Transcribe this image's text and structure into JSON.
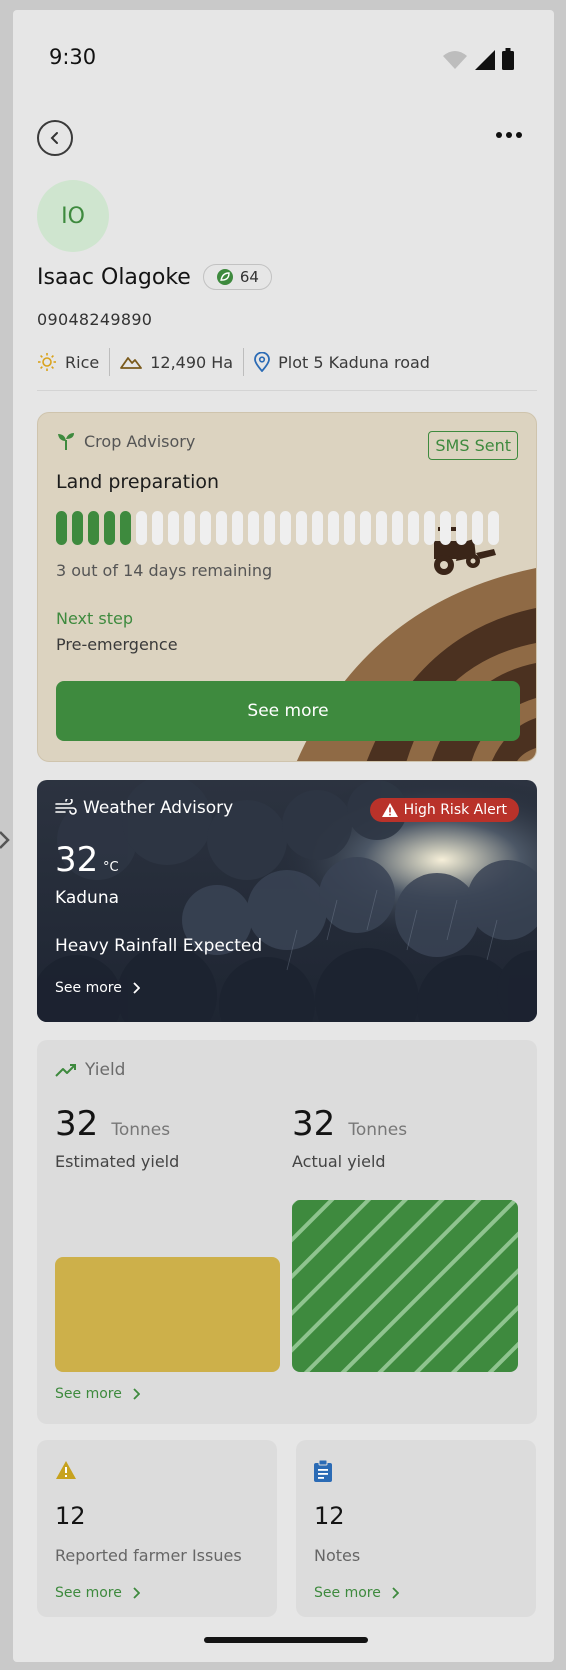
{
  "status_bar": {
    "time": "9:30"
  },
  "profile": {
    "initials": "IO",
    "name": "Isaac Olagoke",
    "score": "64",
    "phone": "09048249890",
    "crop": "Rice",
    "area": "12,490 Ha",
    "location": "Plot 5 Kaduna road"
  },
  "crop_advisory": {
    "title": "Crop Advisory",
    "sms_status": "SMS Sent",
    "stage": "Land preparation",
    "progress_completed_segments": 5,
    "progress_total_segments": 28,
    "days_text": "3 out of 14 days remaining",
    "next_label": "Next step",
    "next_value": "Pre-emergence",
    "button_label": "See more"
  },
  "weather_advisory": {
    "title": "Weather Advisory",
    "alert": "High Risk Alert",
    "temperature": "32",
    "unit": "°C",
    "city": "Kaduna",
    "forecast": "Heavy Rainfall Expected",
    "link": "See more"
  },
  "yield": {
    "title": "Yield",
    "estimated": {
      "value": "32",
      "unit": "Tonnes",
      "label": "Estimated yield"
    },
    "actual": {
      "value": "32",
      "unit": "Tonnes",
      "label": "Actual yield"
    },
    "link": "See more"
  },
  "issues": {
    "count": "12",
    "label": "Reported farmer Issues",
    "link": "See more"
  },
  "notes": {
    "count": "12",
    "label": "Notes",
    "link": "See more"
  },
  "colors": {
    "primary_green": "#3e8a3e",
    "alert_red": "#b9322a",
    "estimated_bar": "#cdb04a",
    "card_beige": "#dcd3c0"
  }
}
